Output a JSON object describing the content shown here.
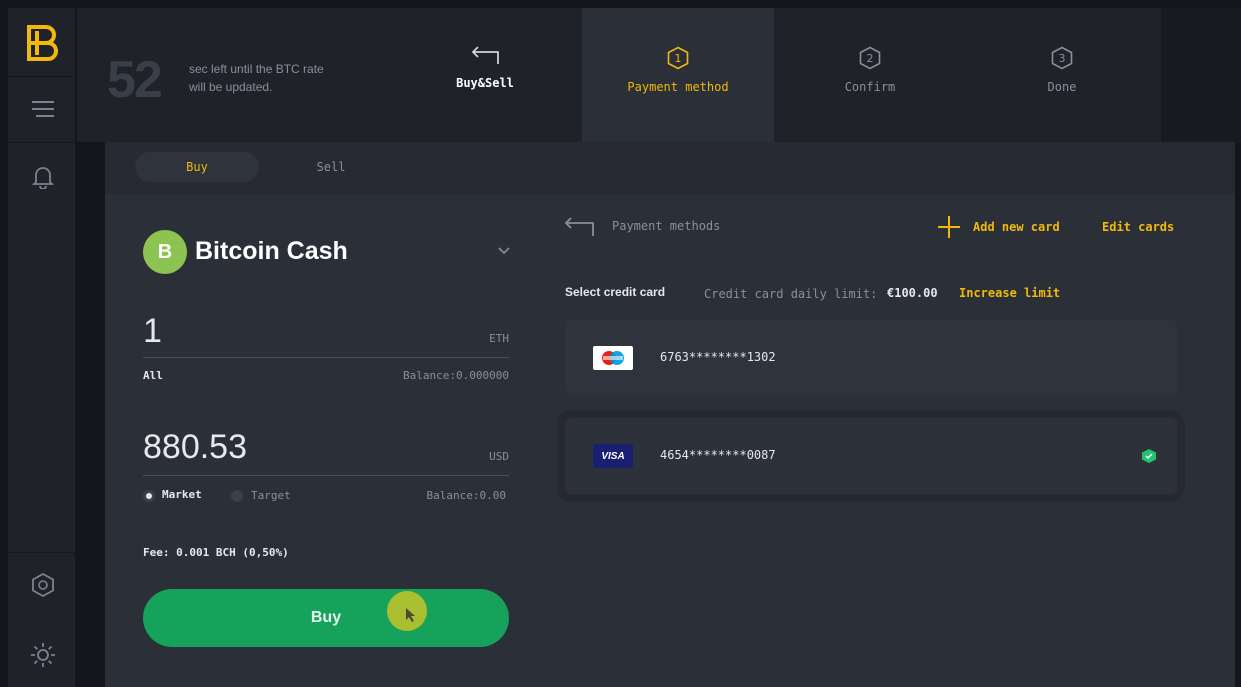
{
  "timer": {
    "seconds": "52",
    "text": "sec left until the BTC rate will be updated."
  },
  "steps": [
    {
      "label": "Buy&Sell",
      "icon": "back-arrow-icon"
    },
    {
      "label": "Payment method",
      "number": "1"
    },
    {
      "label": "Confirm",
      "number": "2"
    },
    {
      "label": "Done",
      "number": "3"
    }
  ],
  "tabs": {
    "buy": "Buy",
    "sell": "Sell"
  },
  "coin": {
    "name": "Bitcoin Cash",
    "symbol": "B"
  },
  "crypto_amount": {
    "value": "1",
    "unit": "ETH",
    "all_label": "All",
    "balance": "Balance:0.000000"
  },
  "fiat_amount": {
    "value": "880.53",
    "unit": "USD",
    "balance": "Balance:0.00"
  },
  "order_type": {
    "market": "Market",
    "target": "Target",
    "selected": "Market"
  },
  "fee": "Fee: 0.001 BCH (0,50%)",
  "buy_button": "Buy",
  "payment": {
    "title": "Payment methods",
    "add_card": "Add new card",
    "edit_cards": "Edit cards",
    "select_label": "Select credit card",
    "limit_label": "Credit card daily limit:",
    "limit_value": "€100.00",
    "increase_limit": "Increase limit",
    "cards": [
      {
        "number": "6763********1302",
        "brand": "Maestro",
        "selected": false
      },
      {
        "number": "4654********0087",
        "brand": "VISA",
        "selected": true
      }
    ]
  },
  "colors": {
    "accent": "#f0b90b",
    "buy": "#16a25a",
    "coin": "#8dc351",
    "check": "#21c36e"
  }
}
